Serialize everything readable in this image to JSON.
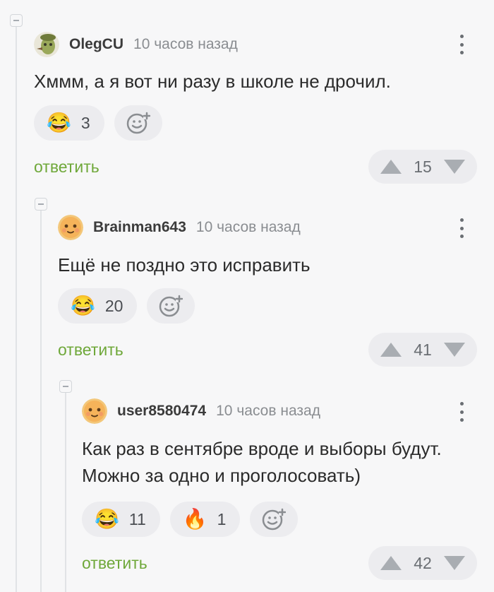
{
  "comments": [
    {
      "username": "OlegCU",
      "time": "10 часов назад",
      "text": "Хммм, а я вот ни разу в школе не дрочил.",
      "reactions": [
        {
          "icon": "laughing-tears-emoji",
          "count": "3"
        }
      ],
      "reply_label": "ответить",
      "rating": "15"
    },
    {
      "username": "Brainman643",
      "time": "10 часов назад",
      "text": "Ещё не поздно это исправить",
      "reactions": [
        {
          "icon": "laughing-tears-emoji",
          "count": "20"
        }
      ],
      "reply_label": "ответить",
      "rating": "41"
    },
    {
      "username": "user8580474",
      "time": "10 часов назад",
      "text_line1": "Как раз в сентябре вроде и выборы будут.",
      "text_line2": "Можно за одно и проголосовать)",
      "reactions": [
        {
          "icon": "laughing-tears-emoji",
          "count": "11"
        },
        {
          "icon": "fire-emoji",
          "count": "1"
        }
      ],
      "reply_label": "ответить",
      "rating": "42"
    }
  ],
  "colors": {
    "accent_reply": "#6fa83a",
    "background": "#f7f7f8",
    "pill": "#ececef"
  }
}
